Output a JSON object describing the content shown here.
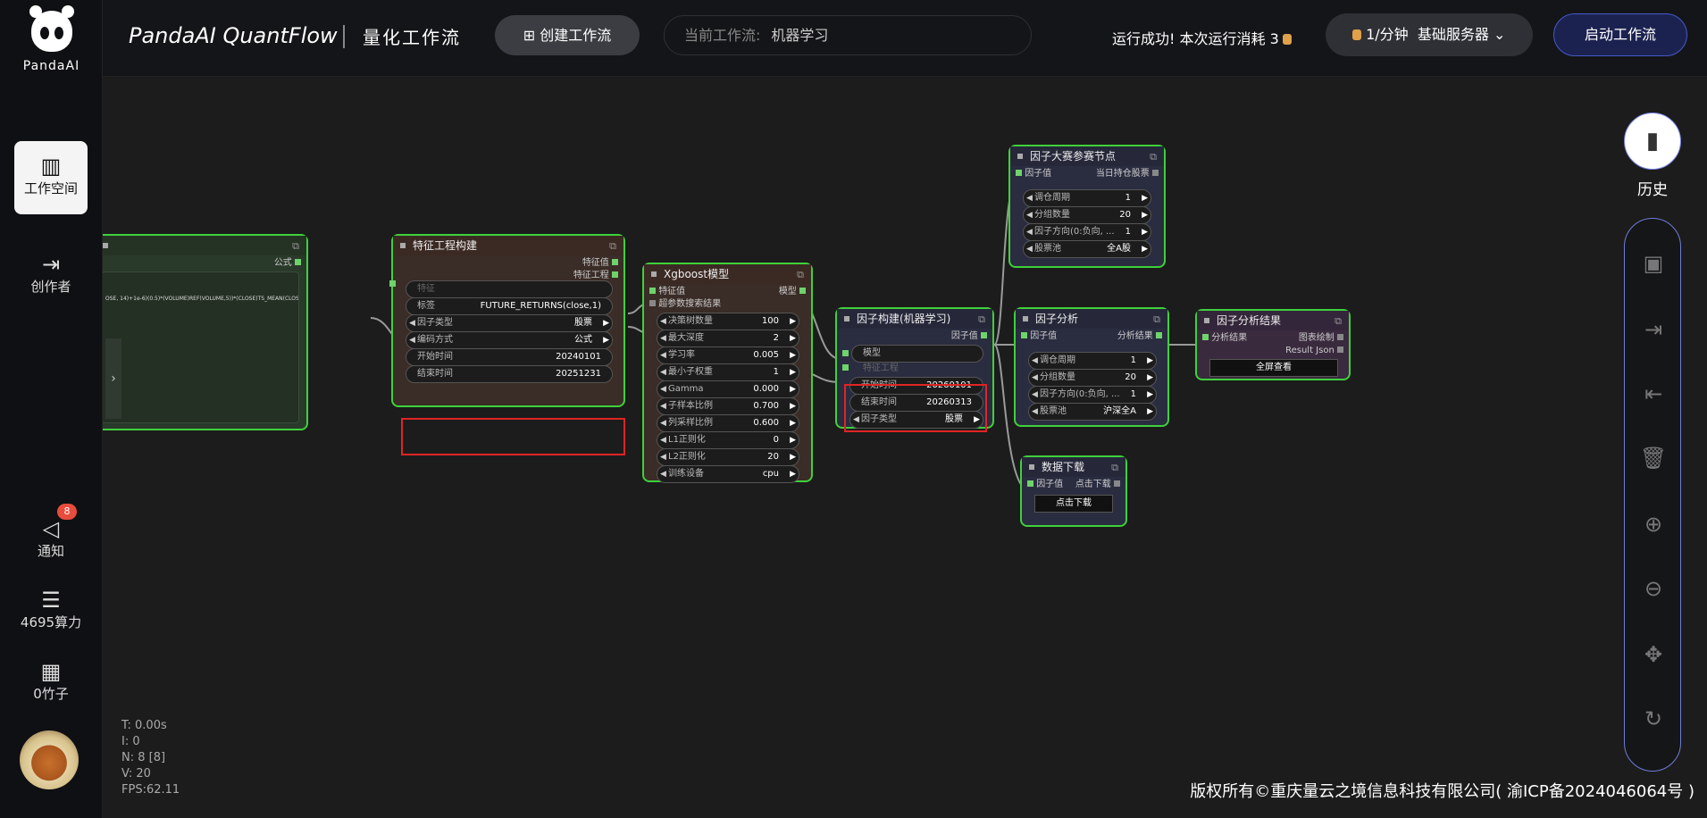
{
  "brand": {
    "logo_text": "PandaAI",
    "title": "PandaAI QuantFlow",
    "title_cn": "量化工作流"
  },
  "header": {
    "create_label": "创建工作流",
    "wf_label": "当前工作流:",
    "wf_value": "机器学习",
    "run_status": "运行成功!",
    "run_cost": "本次运行消耗 3",
    "rate": "1/分钟",
    "server": "基础服务器",
    "start_label": "启动工作流"
  },
  "sidebar": {
    "workspace": "工作空间",
    "creator": "创作者",
    "notify": "通知",
    "notify_count": "8",
    "compute": "4695算力",
    "bamboo": "0竹子"
  },
  "right": {
    "history": "历史"
  },
  "debug": {
    "t": "T: 0.00s",
    "i": "I: 0",
    "n": "N: 8 [8]",
    "v": "V: 20",
    "fps": "FPS:62.11"
  },
  "footer": {
    "copyright": "版权所有©重庆量云之境信息科技有限公司( 渝ICP备2024046064号 )"
  },
  "nodes": {
    "formula": {
      "out": "公式",
      "text": "OSE, 14)+1e-6)(0.5)*(VOLUME)REF(VOLUME,5))*(CLOSE)TS_MEAN(CLOSE,5)))"
    },
    "feature": {
      "title": "特征工程构建",
      "out1": "特征值",
      "out2": "特征工程",
      "w_feature": "特征",
      "w_label": "标签",
      "w_label_v": "FUTURE_RETURNS(close,1)",
      "w_type": "因子类型",
      "w_type_v": "股票",
      "w_enc": "编码方式",
      "w_enc_v": "公式",
      "w_start": "开始时间",
      "w_start_v": "20240101",
      "w_end": "结束时间",
      "w_end_v": "20251231"
    },
    "xgb": {
      "title": "Xgboost模型",
      "in1": "特征值",
      "in2": "超参数搜索结果",
      "out": "模型",
      "params": [
        [
          "决策树数量",
          "100"
        ],
        [
          "最大深度",
          "2"
        ],
        [
          "学习率",
          "0.005"
        ],
        [
          "最小子权重",
          "1"
        ],
        [
          "Gamma",
          "0.000"
        ],
        [
          "子样本比例",
          "0.700"
        ],
        [
          "列采样比例",
          "0.600"
        ],
        [
          "L1正则化",
          "0"
        ],
        [
          "L2正则化",
          "20"
        ],
        [
          "训练设备",
          "cpu"
        ]
      ]
    },
    "fbuild": {
      "title": "因子构建(机器学习)",
      "out": "因子值",
      "in1": "模型",
      "in2": "特征工程",
      "w_start": "开始时间",
      "w_start_v": "20260101",
      "w_end": "结束时间",
      "w_end_v": "20260313",
      "w_type": "因子类型",
      "w_type_v": "股票"
    },
    "contest": {
      "title": "因子大赛参赛节点",
      "in": "因子值",
      "out": "当日持仓股票",
      "params": [
        [
          "调仓周期",
          "1"
        ],
        [
          "分组数量",
          "20"
        ],
        [
          "因子方向(0:负向, ...",
          "1"
        ],
        [
          "股票池",
          "全A股"
        ]
      ]
    },
    "analysis": {
      "title": "因子分析",
      "in": "因子值",
      "out": "分析结果",
      "params": [
        [
          "调仓周期",
          "1"
        ],
        [
          "分组数量",
          "20"
        ],
        [
          "因子方向(0:负向, ...",
          "1"
        ],
        [
          "股票池",
          "沪深全A"
        ]
      ]
    },
    "result": {
      "title": "因子分析结果",
      "in": "分析结果",
      "out1": "图表绘制",
      "out2": "Result Json",
      "button": "全屏查看"
    },
    "download": {
      "title": "数据下载",
      "in": "因子值",
      "out": "点击下载",
      "button": "点击下载"
    }
  }
}
